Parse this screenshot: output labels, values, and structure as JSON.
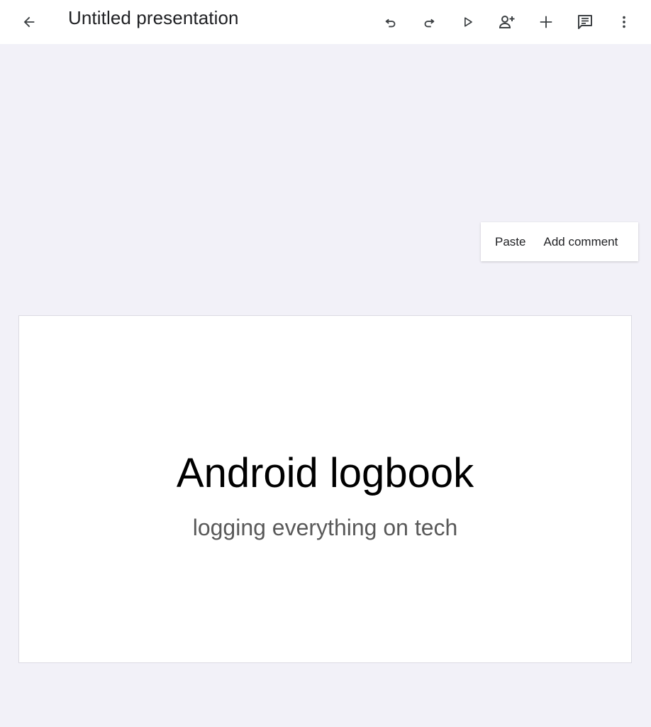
{
  "toolbar": {
    "title": "Untitled presentation",
    "icons": [
      "back-arrow-icon",
      "undo-icon",
      "redo-icon",
      "present-icon",
      "share-icon",
      "insert-icon",
      "comment-icon",
      "more-vert-icon"
    ]
  },
  "context_menu": {
    "items": [
      "Paste",
      "Add comment"
    ]
  },
  "slide": {
    "title": "Android logbook",
    "subtitle": "logging everything on tech"
  },
  "colors": {
    "background": "#f2f1f8",
    "toolbar": "#ffffff",
    "icon": "#3c4043",
    "slide_title": "#000000",
    "slide_subtitle": "#595959"
  }
}
